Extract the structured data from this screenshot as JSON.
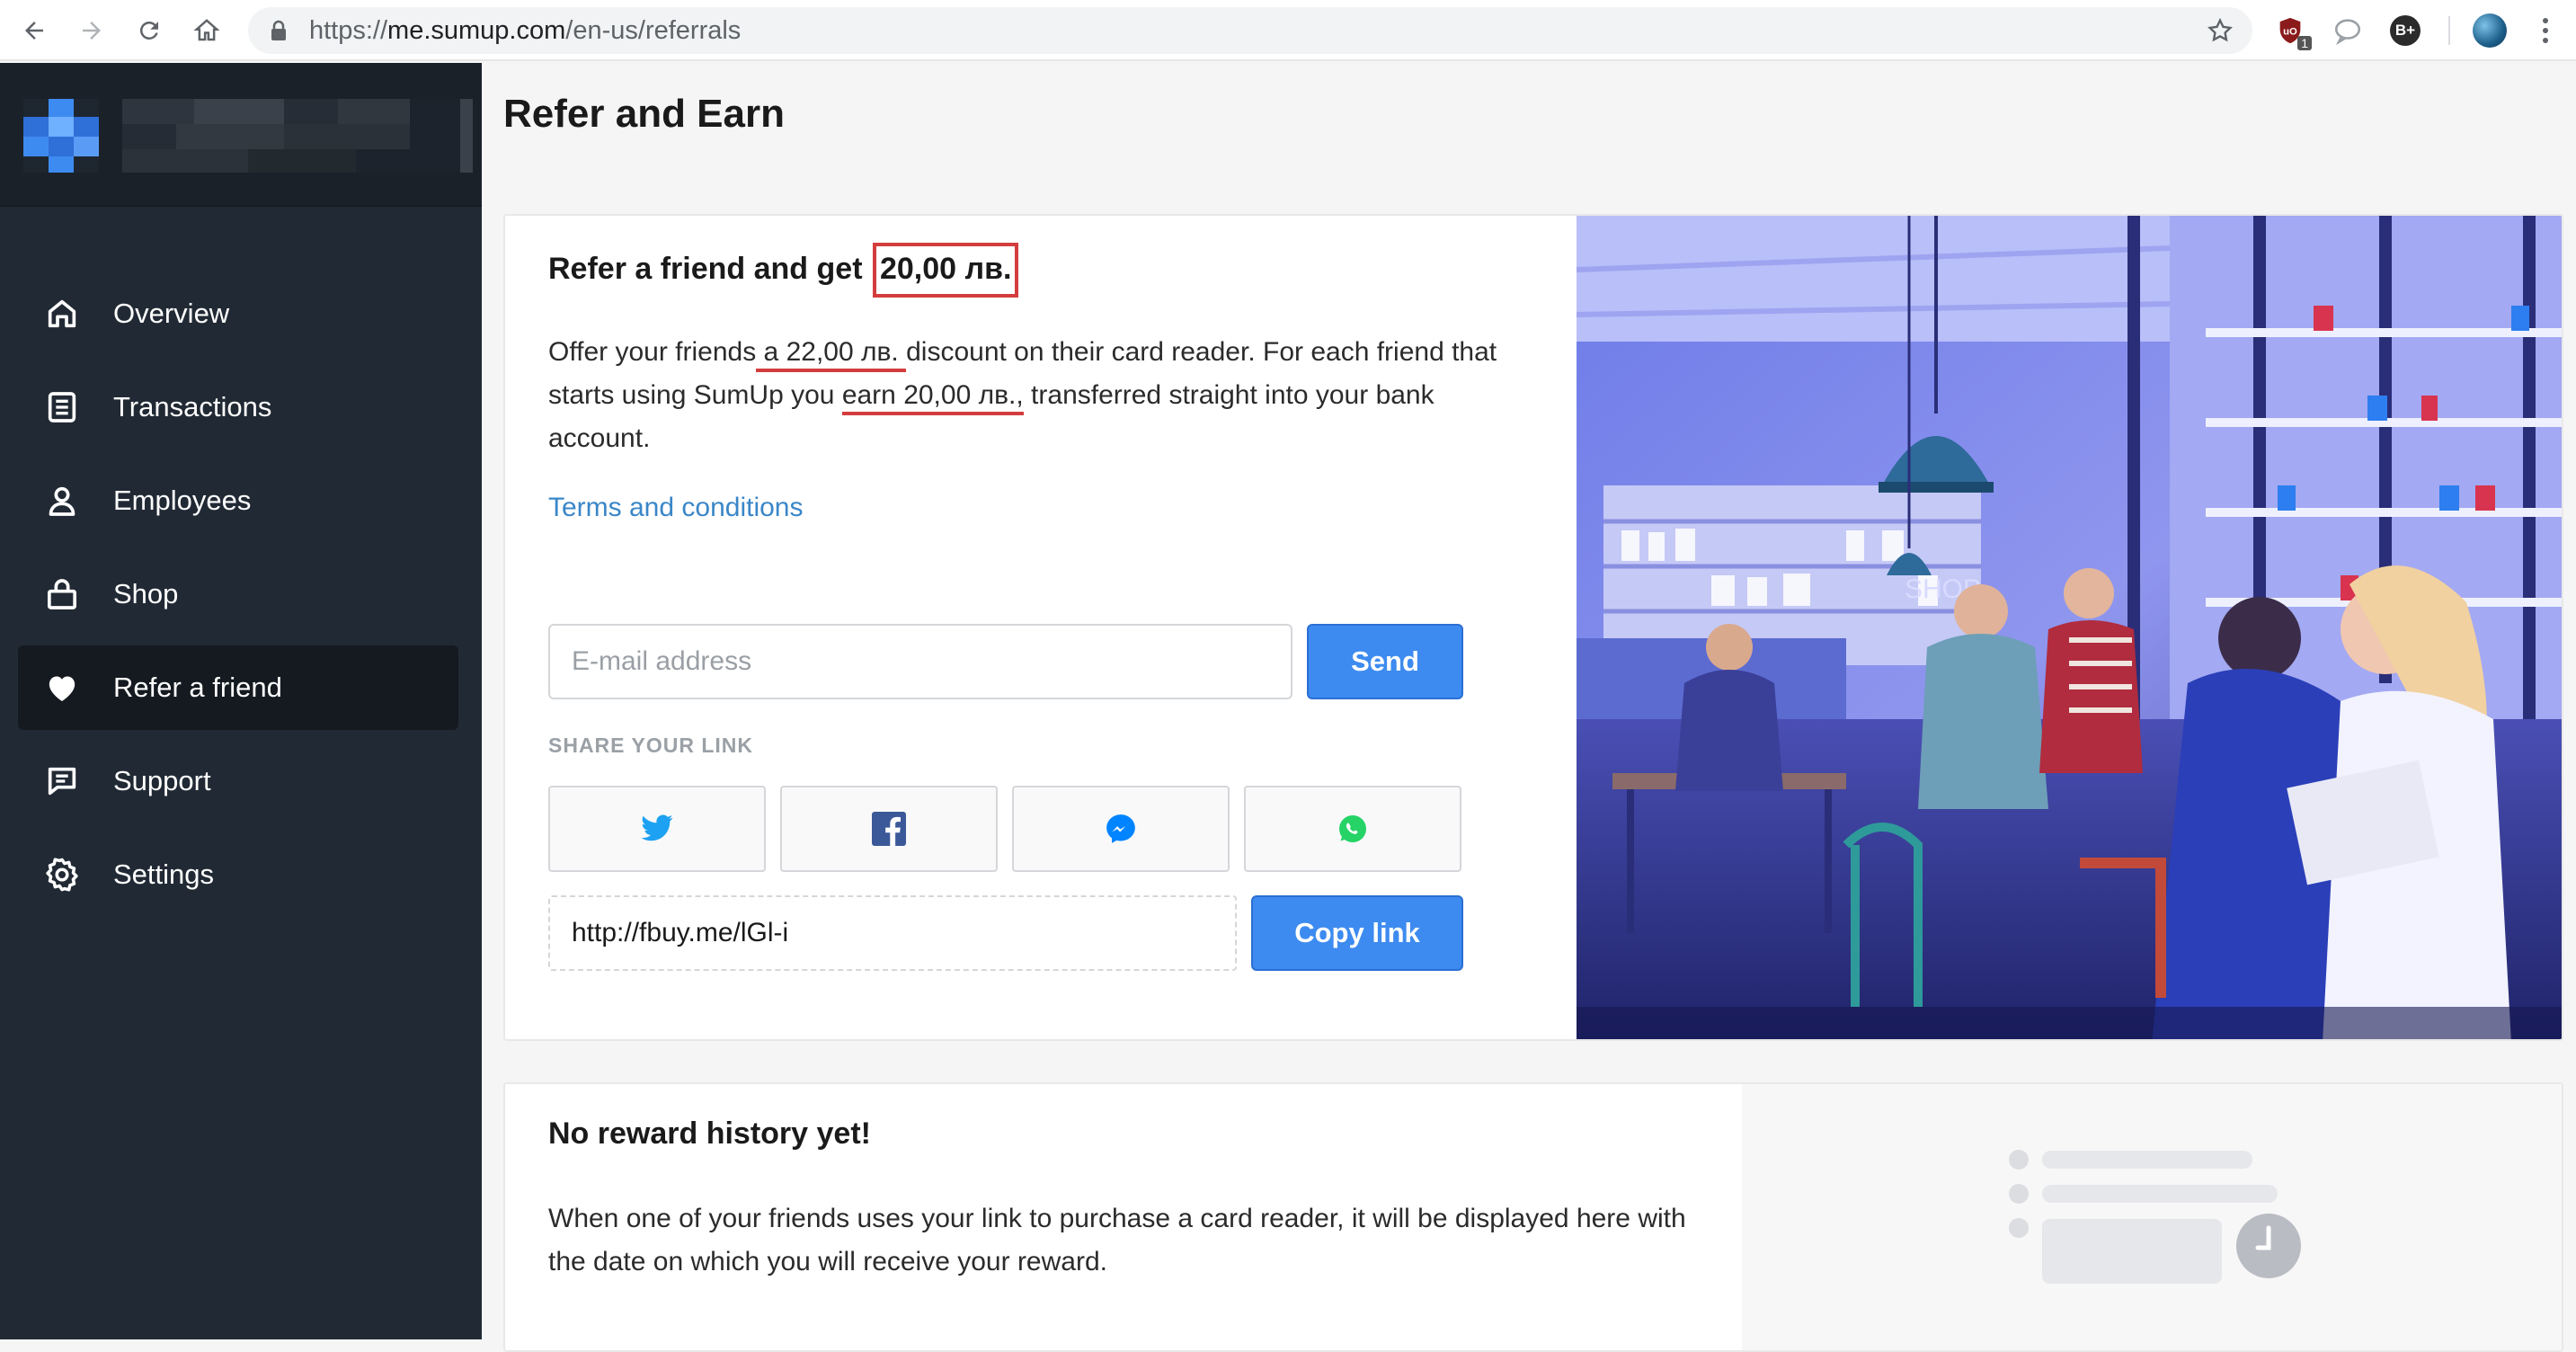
{
  "browser": {
    "url_prefix": "https://",
    "url_host": "me.sumup.com",
    "url_path": "/en-us/referrals",
    "icons": [
      "back-icon",
      "forward-icon",
      "reload-icon",
      "home-icon",
      "lock-icon",
      "star-icon",
      "ublock-icon",
      "chat-icon",
      "extension-icon",
      "profile-avatar",
      "menu-icon"
    ],
    "ext_badge": "1",
    "ext_label": "B+"
  },
  "sidebar": {
    "items": [
      {
        "label": "Overview",
        "icon": "home-icon"
      },
      {
        "label": "Transactions",
        "icon": "document-icon"
      },
      {
        "label": "Employees",
        "icon": "user-icon"
      },
      {
        "label": "Shop",
        "icon": "bag-icon"
      },
      {
        "label": "Refer a friend",
        "icon": "heart-icon",
        "active": true
      },
      {
        "label": "Support",
        "icon": "message-icon"
      },
      {
        "label": "Settings",
        "icon": "gear-icon"
      }
    ]
  },
  "page": {
    "title": "Refer and Earn"
  },
  "referral": {
    "headline_prefix": "Refer a friend and get ",
    "headline_amount": "20,00 лв.",
    "desc_part1": "Offer your friends",
    "desc_discount": " a 22,00 лв. ",
    "desc_part2": "discount on their card reader. For each friend that starts using SumUp you ",
    "desc_earn": "earn 20,00 лв.,",
    "desc_part3": " transferred straight into your bank account.",
    "terms_link": "Terms and conditions",
    "email_placeholder": "E-mail address",
    "send_label": "Send",
    "share_label": "SHARE YOUR LINK",
    "share_buttons": [
      "twitter-icon",
      "facebook-icon",
      "messenger-icon",
      "whatsapp-icon"
    ],
    "share_link": "http://fbuy.me/lGl-i",
    "copy_label": "Copy link",
    "photo_sign": "SHOP"
  },
  "history": {
    "title": "No reward history yet!",
    "text": "When one of your friends uses your link to purchase a card reader, it will be displayed here with the date on which you will receive your reward."
  },
  "colors": {
    "sidebar_bg": "#212a34",
    "primary_button": "#3d8bf0",
    "link": "#3a86c8",
    "highlight": "#d43d3d",
    "twitter": "#1da1f2",
    "facebook": "#3b5998",
    "messenger": "#0084ff",
    "whatsapp": "#25d366"
  }
}
